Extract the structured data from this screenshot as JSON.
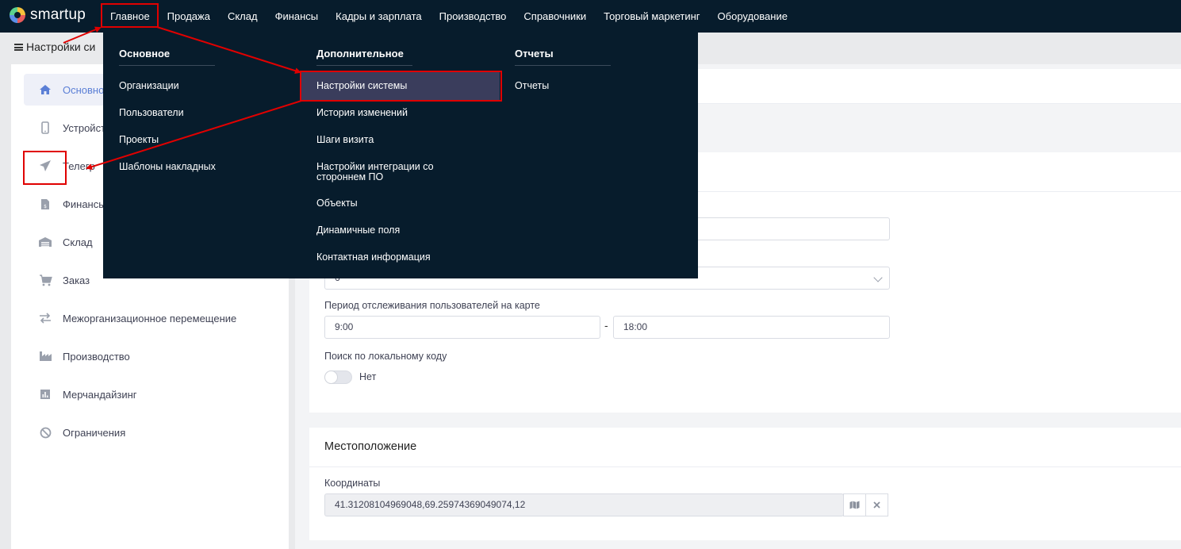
{
  "app": {
    "logo_text": "smartup"
  },
  "topnav": {
    "items": [
      "Главное",
      "Продажа",
      "Склад",
      "Финансы",
      "Кадры и зарплата",
      "Производство",
      "Справочники",
      "Торговый маркетинг",
      "Оборудование"
    ],
    "active": "Главное"
  },
  "page": {
    "title": "Настройки си"
  },
  "sidebar": {
    "items": [
      {
        "label": "Основно",
        "icon": "home-icon"
      },
      {
        "label": "Устройст",
        "icon": "mobile-icon"
      },
      {
        "label": "Телегр",
        "icon": "paper-plane-icon"
      },
      {
        "label": "Финансы",
        "icon": "document-dollar-icon"
      },
      {
        "label": "Склад",
        "icon": "warehouse-icon"
      },
      {
        "label": "Заказ",
        "icon": "cart-icon"
      },
      {
        "label": "Межорганизационное перемещение",
        "icon": "exchange-icon"
      },
      {
        "label": "Производство",
        "icon": "factory-icon"
      },
      {
        "label": "Мерчандайзинг",
        "icon": "bar-chart-icon"
      },
      {
        "label": "Ограничения",
        "icon": "ban-icon"
      }
    ]
  },
  "dropdown": {
    "col1": {
      "heading": "Основное",
      "items": [
        "Организации",
        "Пользователи",
        "Проекты",
        "Шаблоны накладных"
      ]
    },
    "col2": {
      "heading": "Дополнительное",
      "items": [
        "Настройки системы",
        "История изменений",
        "Шаги визита",
        "Настройки интеграции со",
        "стороннем ПО",
        "Объекты",
        "Динамичные поля",
        "Контактная информация"
      ]
    },
    "col3": {
      "heading": "Отчеты",
      "items": [
        "Отчеты"
      ]
    }
  },
  "main": {
    "select_value": "6",
    "tracking_label": "Период отслеживания пользователей на карте",
    "time_from": "9:00",
    "time_separator": "-",
    "time_to": "18:00",
    "local_code_label": "Поиск по локальному коду",
    "local_code_toggle": "Нет",
    "location_title": "Местоположение",
    "coordinates_label": "Координаты",
    "coordinates_value": "41.31208104969048,69.25974369049074,12"
  },
  "colors": {
    "nav_bg": "#071c2c",
    "highlight": "#e00000",
    "accent": "#5b7fd6"
  }
}
